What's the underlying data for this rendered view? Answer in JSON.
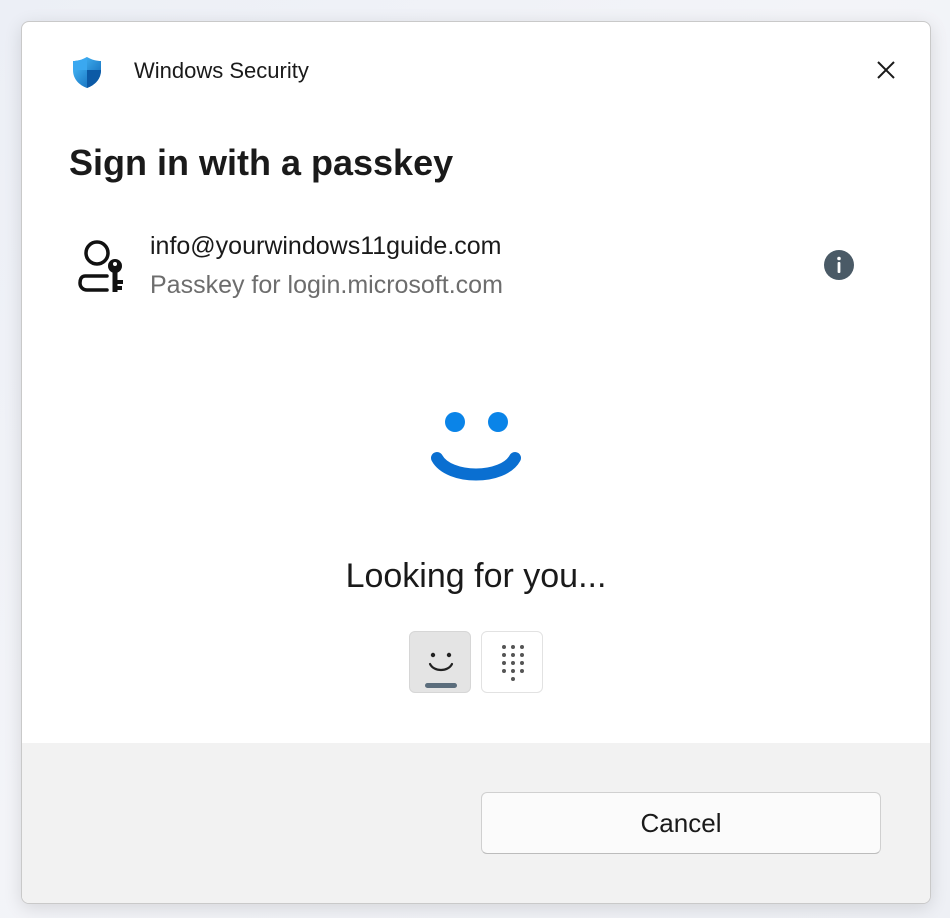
{
  "app": {
    "title": "Windows Security",
    "icon": "windows-security-shield-icon"
  },
  "dialog": {
    "heading": "Sign in with a passkey",
    "close_icon": "close-icon"
  },
  "account": {
    "icon": "user-key-icon",
    "email": "info@yourwindows11guide.com",
    "subtitle": "Passkey for login.microsoft.com",
    "info_icon": "info-icon"
  },
  "auth": {
    "status_icon": "windows-hello-face-icon",
    "status_text": "Looking for you...",
    "methods": [
      {
        "name": "face",
        "icon": "face-icon",
        "selected": true
      },
      {
        "name": "pin",
        "icon": "pin-keypad-icon",
        "selected": false
      }
    ]
  },
  "footer": {
    "cancel_label": "Cancel"
  },
  "colors": {
    "accent_blue": "#0078d4",
    "shield_blue": "#1a86d9",
    "info_badge": "#4a5a66",
    "footer_bg": "#f2f2f2"
  }
}
